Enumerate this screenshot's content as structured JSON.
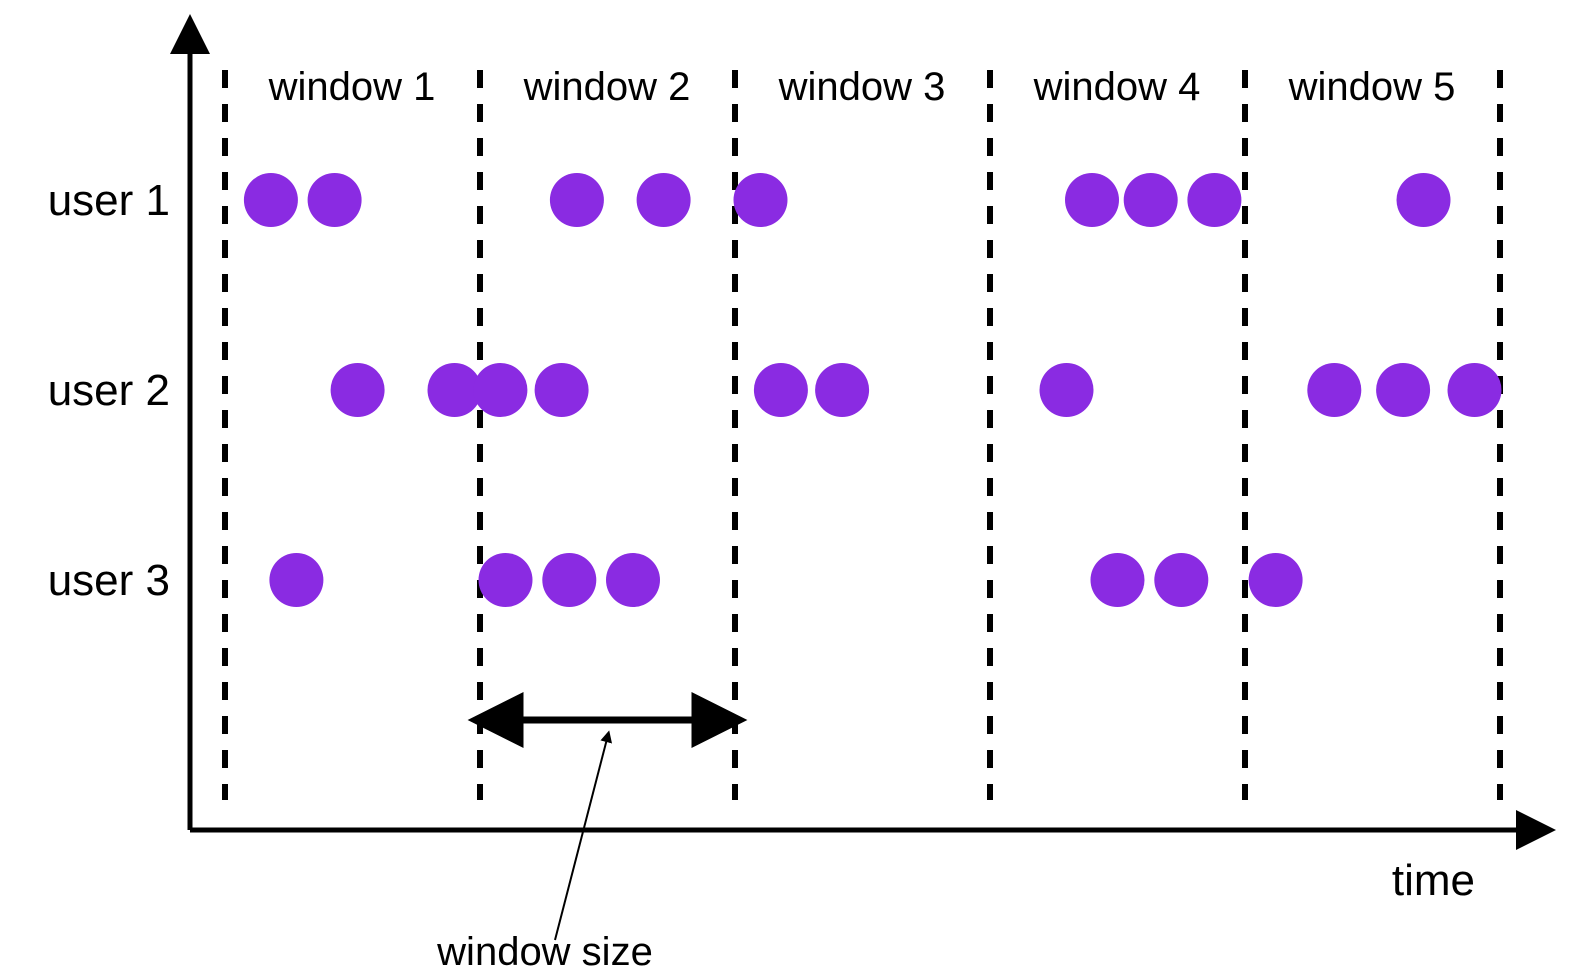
{
  "chart_data": {
    "type": "scatter",
    "title": "",
    "xlabel": "time",
    "ylabel": "",
    "y_categories": [
      "user 1",
      "user 2",
      "user 3"
    ],
    "windows": [
      "window 1",
      "window 2",
      "window 3",
      "window 4",
      "window 5"
    ],
    "window_size_label": "window size",
    "series": [
      {
        "name": "user 1",
        "events_by_window": [
          [
            0.18,
            0.43
          ],
          [
            0.38,
            0.72
          ],
          [
            0.1
          ],
          [
            0.4,
            0.63,
            0.88
          ],
          [
            0.7
          ]
        ]
      },
      {
        "name": "user 2",
        "events_by_window": [
          [
            0.52,
            0.9
          ],
          [
            0.08,
            0.32
          ],
          [
            0.18,
            0.42
          ],
          [
            0.3
          ],
          [
            0.35,
            0.62,
            0.9
          ]
        ]
      },
      {
        "name": "user 3",
        "events_by_window": [
          [
            0.28
          ],
          [
            0.1,
            0.35,
            0.6
          ],
          [],
          [
            0.5,
            0.75
          ],
          [
            0.12
          ]
        ]
      }
    ],
    "annotations": [
      "window size indicator spans window 2"
    ]
  },
  "labels": {
    "xaxis": "time",
    "window_size": "window size",
    "users": [
      "user 1",
      "user 2",
      "user 3"
    ],
    "windows": [
      "window 1",
      "window 2",
      "window 3",
      "window 4",
      "window 5"
    ]
  },
  "colors": {
    "dot": "#8A2BE2",
    "axis": "#000000",
    "background": "#ffffff"
  }
}
